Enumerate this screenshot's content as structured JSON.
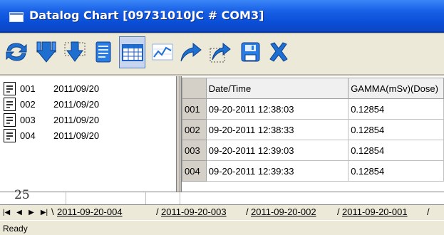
{
  "window": {
    "title": "Datalog Chart [09731010JC # COM3]"
  },
  "toolbar": {
    "buttons": [
      {
        "name": "refresh",
        "icon": "refresh-arrows-icon"
      },
      {
        "name": "download-all",
        "icon": "download-arrow-icon"
      },
      {
        "name": "download-selected",
        "icon": "download-select-icon"
      },
      {
        "name": "document",
        "icon": "document-icon"
      },
      {
        "name": "table-view",
        "icon": "table-icon",
        "active": true
      },
      {
        "name": "chart-view",
        "icon": "line-chart-icon"
      },
      {
        "name": "export",
        "icon": "export-arrow-icon"
      },
      {
        "name": "export-selected",
        "icon": "export-select-icon"
      },
      {
        "name": "save",
        "icon": "floppy-disk-icon"
      },
      {
        "name": "close",
        "icon": "close-x-icon"
      }
    ]
  },
  "log_list": {
    "items": [
      {
        "num": "001",
        "date": "2011/09/20"
      },
      {
        "num": "002",
        "date": "2011/09/20"
      },
      {
        "num": "003",
        "date": "2011/09/20"
      },
      {
        "num": "004",
        "date": "2011/09/20"
      }
    ]
  },
  "grid": {
    "headers": [
      "Date/Time",
      "GAMMA(mSv)(Dose)"
    ],
    "rows": [
      {
        "id": "001",
        "datetime": "09-20-2011 12:38:03",
        "value": "0.12854"
      },
      {
        "id": "002",
        "datetime": "09-20-2011 12:38:33",
        "value": "0.12854"
      },
      {
        "id": "003",
        "datetime": "09-20-2011 12:39:03",
        "value": "0.12854"
      },
      {
        "id": "004",
        "datetime": "09-20-2011 12:39:33",
        "value": "0.12854"
      }
    ]
  },
  "axis_fragment": "25",
  "sheets": {
    "tabs": [
      "2011-09-20-004",
      "2011-09-20-003",
      "2011-09-20-002",
      "2011-09-20-001"
    ]
  },
  "status": {
    "text": "Ready"
  },
  "colors": {
    "title_bar": "#0a4fd8",
    "toolbar_bg": "#ece9d8",
    "icon_blue": "#1f6fd1"
  }
}
